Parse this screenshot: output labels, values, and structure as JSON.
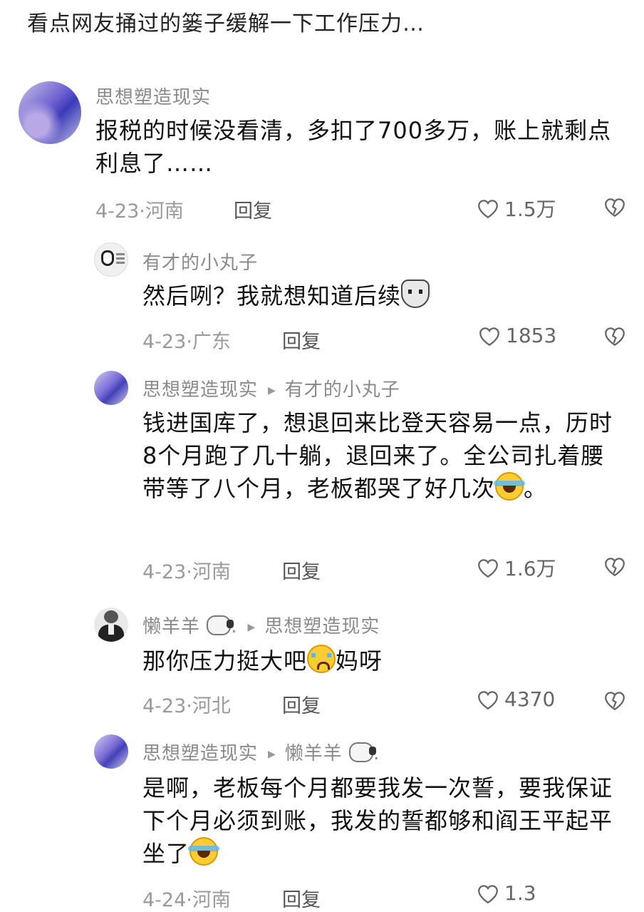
{
  "post": {
    "title": "看点网友捅过的篓子缓解一下工作压力…"
  },
  "comments": [
    {
      "name": "思想塑造现实",
      "text": "报税的时候没看清，多扣了700多万，账上就剩点利息了……",
      "date": "4-23",
      "location": "河南",
      "reply": "回复",
      "likes": "1.5万"
    },
    {
      "name": "有才的小丸子",
      "text": "然后咧？我就想知道后续",
      "emoji": "husky-emoji",
      "date": "4-23",
      "location": "广东",
      "reply": "回复",
      "likes": "1853"
    },
    {
      "name": "思想塑造现实",
      "reply_to": "有才的小丸子",
      "text": "钱进国库了，想退回来比登天容易一点，历时8个月跑了几十躺，退回来了。全公司扎着腰带等了八个月，老板都哭了好几次",
      "text_end": "。",
      "emoji": "laugh-cry-emoji",
      "date": "4-23",
      "location": "河南",
      "reply": "回复",
      "likes": "1.6万"
    },
    {
      "name": "懒羊羊",
      "name_suffix": ".",
      "reply_to": "思想塑造现实",
      "text": "那你压力挺大吧",
      "text_end": "妈呀",
      "emoji": "crying-emoji",
      "date": "4-23",
      "location": "河北",
      "reply": "回复",
      "likes": "4370"
    },
    {
      "name": "思想塑造现实",
      "reply_to": "懒羊羊",
      "reply_to_suffix": ".",
      "text": "是啊，老板每个月都要我发一次誓，要我保证下个月必须到账，我发的誓都够和阎王平起平坐了",
      "emoji": "laugh-cry-emoji",
      "date": "4-24",
      "location": "河南",
      "reply": "回复",
      "likes": "1.3"
    }
  ],
  "icons": {
    "like": "heart-outline-icon",
    "dislike": "broken-heart-icon"
  }
}
